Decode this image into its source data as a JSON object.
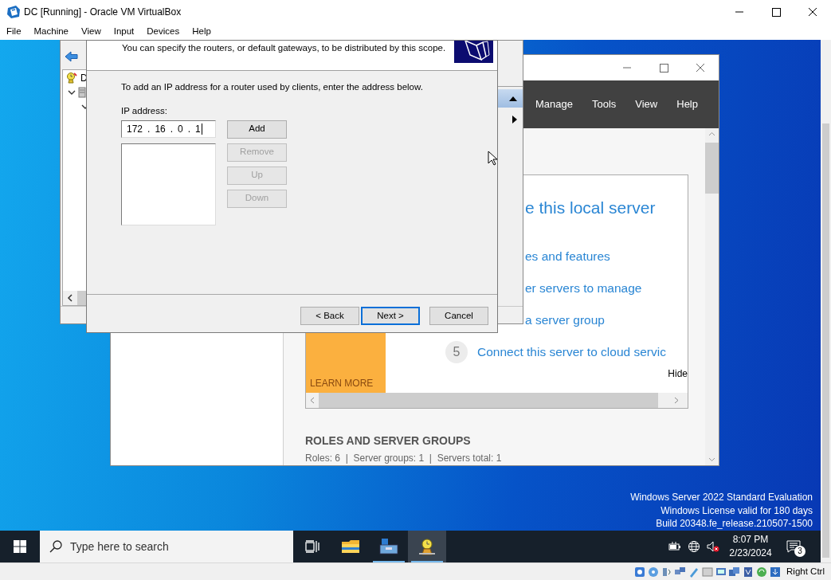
{
  "host": {
    "title": "DC [Running] - Oracle VM VirtualBox",
    "menu": [
      "File",
      "Machine",
      "View",
      "Input",
      "Devices",
      "Help"
    ],
    "host_key": "Right Ctrl"
  },
  "dhcp_console": {
    "tree_root": "D",
    "tree_nodes": [
      {
        "expanded": true
      },
      {
        "expanded": true
      }
    ],
    "action_rows": [
      {
        "selected": true
      },
      {
        "selected": false
      }
    ]
  },
  "wizard": {
    "description": "You can specify the routers, or default gateways, to be distributed by this scope.",
    "instruction": "To add an IP address for a router used by clients, enter the address below.",
    "ip_label": "IP address:",
    "ip_address": {
      "octets": [
        "172",
        "16",
        "0",
        "1"
      ],
      "separator": "."
    },
    "side_buttons": [
      {
        "label": "Add",
        "disabled": false
      },
      {
        "label": "Remove",
        "disabled": true
      },
      {
        "label": "Up",
        "disabled": true
      },
      {
        "label": "Down",
        "disabled": true
      }
    ],
    "nav_buttons": [
      {
        "label": "< Back",
        "default": false
      },
      {
        "label": "Next >",
        "default": true
      },
      {
        "label": "Cancel",
        "default": false
      }
    ]
  },
  "server_manager": {
    "menu": [
      "Manage",
      "Tools",
      "View",
      "Help"
    ],
    "welcome": {
      "heading": "e this local server",
      "steps": [
        {
          "text": "es and features"
        },
        {
          "text": "er servers to manage"
        },
        {
          "text": "a server group"
        },
        {
          "number": "5",
          "text": "Connect this server to cloud servic"
        }
      ],
      "hide": "Hide",
      "learn_more": "LEARN MORE"
    },
    "roles": {
      "title": "ROLES AND SERVER GROUPS",
      "summary": "Roles: 6  |  Server groups: 1  |  Servers total: 1"
    }
  },
  "desktop": {
    "watermark": [
      "Windows Server 2022 Standard Evaluation",
      "Windows License valid for 180 days",
      "Build 20348.fe_release.210507-1500"
    ]
  },
  "taskbar": {
    "search_placeholder": "Type here to search",
    "apps": [
      {
        "kind": "file-explorer",
        "running": false,
        "selected": false
      },
      {
        "kind": "server-manager",
        "running": true,
        "selected": false
      },
      {
        "kind": "dhcp",
        "running": true,
        "selected": true
      }
    ],
    "volume_muted": true,
    "time": "8:07 PM",
    "date": "2/23/2024",
    "notifications": "3"
  }
}
